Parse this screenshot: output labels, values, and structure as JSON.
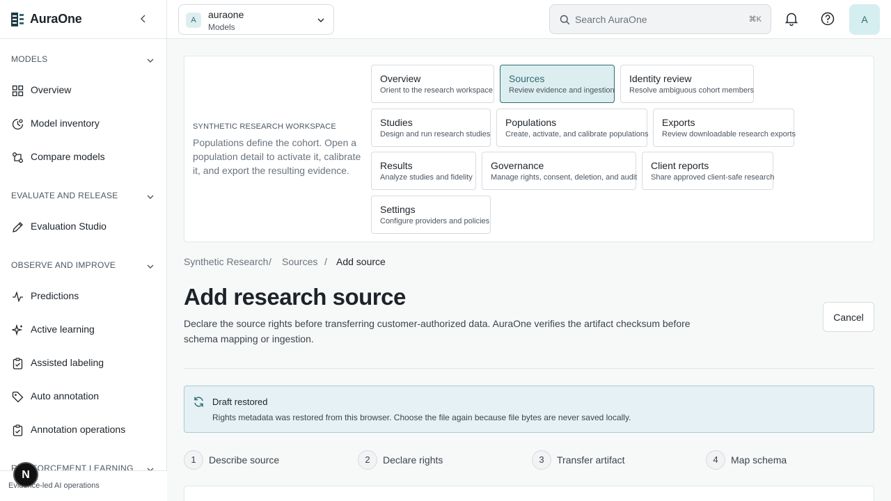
{
  "brand": {
    "name": "AuraOne"
  },
  "sidebar": {
    "sections": [
      {
        "label": "MODELS",
        "items": [
          {
            "label": "Overview",
            "icon": "grid-icon"
          },
          {
            "label": "Model inventory",
            "icon": "model-icon"
          },
          {
            "label": "Compare models",
            "icon": "compare-icon"
          }
        ]
      },
      {
        "label": "EVALUATE AND RELEASE",
        "items": [
          {
            "label": "Evaluation Studio",
            "icon": "pencil-icon"
          }
        ]
      },
      {
        "label": "OBSERVE AND IMPROVE",
        "items": [
          {
            "label": "Predictions",
            "icon": "activity-icon"
          },
          {
            "label": "Active learning",
            "icon": "sparkle-icon"
          },
          {
            "label": "Assisted labeling",
            "icon": "clipboard-icon"
          },
          {
            "label": "Auto annotation",
            "icon": "tag-icon"
          },
          {
            "label": "Annotation operations",
            "icon": "clipboard-check-icon"
          }
        ]
      },
      {
        "label": "REINFORCEMENT LEARNING"
      }
    ],
    "footer_tagline": "Evidence-led AI operations",
    "badge": "N"
  },
  "topbar": {
    "org": {
      "avatar": "A",
      "name": "auraone",
      "sub": "Models"
    },
    "search": {
      "placeholder": "Search AuraOne",
      "shortcut": "⌘K"
    },
    "user_avatar": "A"
  },
  "workspace": {
    "label": "SYNTHETIC RESEARCH WORKSPACE",
    "description": "Populations define the cohort. Open a population detail to activate it, calibrate it, and export the resulting evidence.",
    "cards": [
      {
        "title": "Overview",
        "desc": "Orient to the research workspace"
      },
      {
        "title": "Sources",
        "desc": "Review evidence and ingestion",
        "active": true
      },
      {
        "title": "Identity review",
        "desc": "Resolve ambiguous cohort members"
      },
      {
        "title": "Studies",
        "desc": "Design and run research studies"
      },
      {
        "title": "Populations",
        "desc": "Create, activate, and calibrate populations"
      },
      {
        "title": "Exports",
        "desc": "Review downloadable research exports"
      },
      {
        "title": "Results",
        "desc": "Analyze studies and fidelity"
      },
      {
        "title": "Governance",
        "desc": "Manage rights, consent, deletion, and audit"
      },
      {
        "title": "Client reports",
        "desc": "Share approved client-safe research"
      },
      {
        "title": "Settings",
        "desc": "Configure providers and policies"
      }
    ]
  },
  "breadcrumb": {
    "items": [
      "Synthetic Research",
      "Sources",
      "Add source"
    ],
    "separator": "/"
  },
  "page": {
    "title": "Add research source",
    "description": "Declare the source rights before transferring customer-authorized data. AuraOne verifies the artifact checksum before schema mapping or ingestion.",
    "cancel_label": "Cancel"
  },
  "draft_alert": {
    "title": "Draft restored",
    "message": "Rights metadata was restored from this browser. Choose the file again because file bytes are never saved locally."
  },
  "steps": [
    {
      "num": "1",
      "label": "Describe source"
    },
    {
      "num": "2",
      "label": "Declare rights"
    },
    {
      "num": "3",
      "label": "Transfer artifact"
    },
    {
      "num": "4",
      "label": "Map schema"
    }
  ],
  "colors": {
    "accent": "#2f6b73",
    "accent_bg": "#ddeef0",
    "alert_bg": "#e5f1f4",
    "alert_border": "#a9cbd2"
  }
}
